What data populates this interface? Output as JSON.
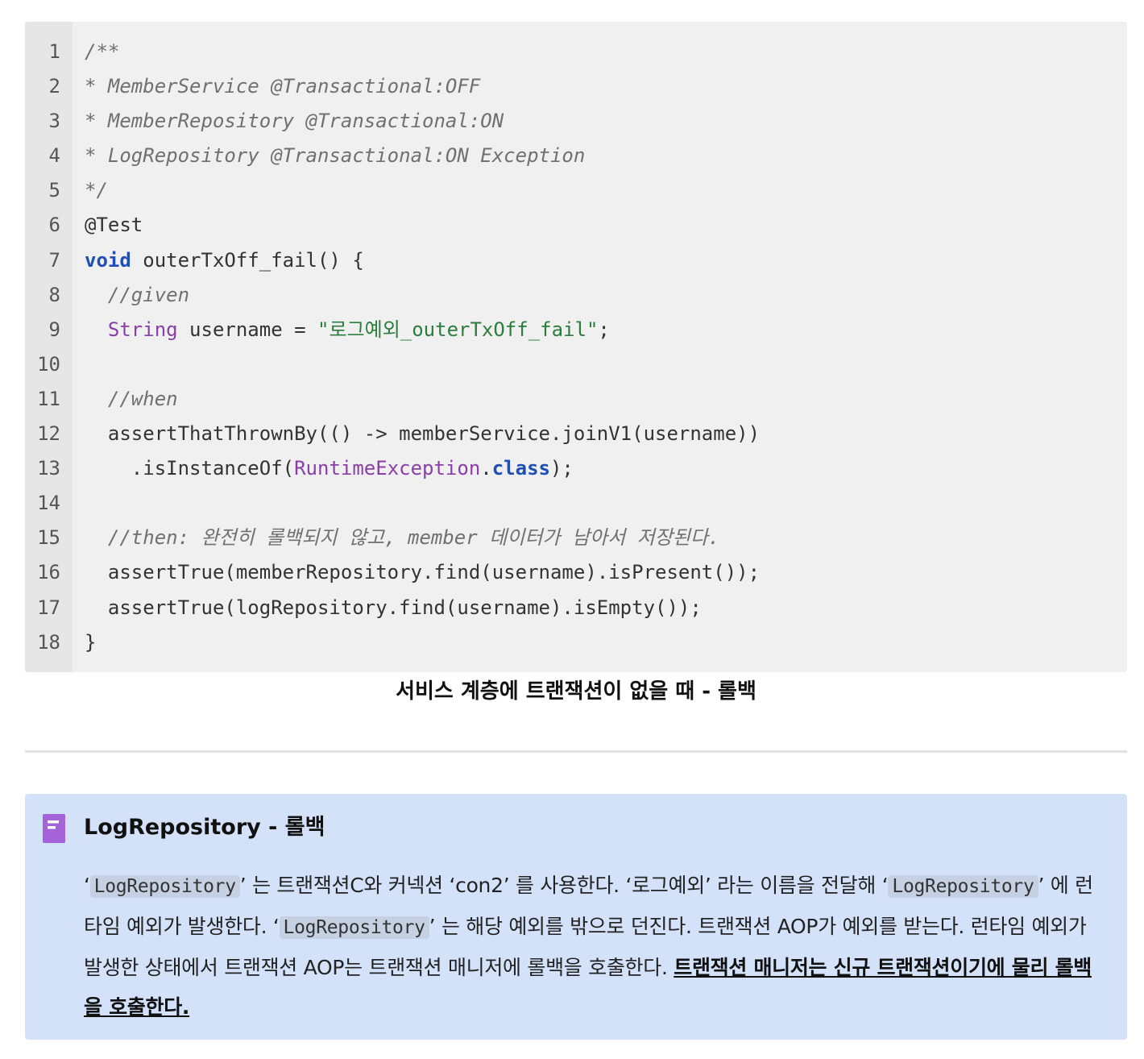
{
  "code": {
    "lines": [
      {
        "n": "1",
        "parts": [
          {
            "t": "/**",
            "c": "cm"
          }
        ]
      },
      {
        "n": "2",
        "parts": [
          {
            "t": "* MemberService @Transactional:OFF",
            "c": "cm"
          }
        ]
      },
      {
        "n": "3",
        "parts": [
          {
            "t": "* MemberRepository @Transactional:ON",
            "c": "cm"
          }
        ]
      },
      {
        "n": "4",
        "parts": [
          {
            "t": "* LogRepository @Transactional:ON Exception",
            "c": "cm"
          }
        ]
      },
      {
        "n": "5",
        "parts": [
          {
            "t": "*/",
            "c": "cm"
          }
        ]
      },
      {
        "n": "6",
        "parts": [
          {
            "t": "@Test",
            "c": ""
          }
        ]
      },
      {
        "n": "7",
        "parts": [
          {
            "t": "void",
            "c": "kw"
          },
          {
            "t": " outerTxOff_fail() {",
            "c": ""
          }
        ]
      },
      {
        "n": "8",
        "parts": [
          {
            "t": "  //given",
            "c": "cm"
          }
        ]
      },
      {
        "n": "9",
        "parts": [
          {
            "t": "  ",
            "c": ""
          },
          {
            "t": "String",
            "c": "ty"
          },
          {
            "t": " username = ",
            "c": ""
          },
          {
            "t": "\"로그예외_outerTxOff_fail\"",
            "c": "st"
          },
          {
            "t": ";",
            "c": ""
          }
        ]
      },
      {
        "n": "10",
        "parts": [
          {
            "t": "",
            "c": ""
          }
        ]
      },
      {
        "n": "11",
        "parts": [
          {
            "t": "  //when",
            "c": "cm"
          }
        ]
      },
      {
        "n": "12",
        "parts": [
          {
            "t": "  assertThatThrownBy(() -> memberService.joinV1(username))",
            "c": ""
          }
        ]
      },
      {
        "n": "13",
        "parts": [
          {
            "t": "    .isInstanceOf(",
            "c": ""
          },
          {
            "t": "RuntimeException",
            "c": "ty"
          },
          {
            "t": ".",
            "c": ""
          },
          {
            "t": "class",
            "c": "kw"
          },
          {
            "t": ");",
            "c": ""
          }
        ]
      },
      {
        "n": "14",
        "parts": [
          {
            "t": "",
            "c": ""
          }
        ]
      },
      {
        "n": "15",
        "parts": [
          {
            "t": "  //then: 완전히 롤백되지 않고, member 데이터가 남아서 저장된다.",
            "c": "cm"
          }
        ]
      },
      {
        "n": "16",
        "parts": [
          {
            "t": "  assertTrue(memberRepository.find(username).isPresent());",
            "c": ""
          }
        ]
      },
      {
        "n": "17",
        "parts": [
          {
            "t": "  assertTrue(logRepository.find(username).isEmpty());",
            "c": ""
          }
        ]
      },
      {
        "n": "18",
        "parts": [
          {
            "t": "}",
            "c": ""
          }
        ]
      }
    ]
  },
  "caption": "서비스 계층에 트랜잭션이 없을 때 - 롤백",
  "callout": {
    "icon": "page-icon",
    "icon_color": "#a463d8",
    "title": "LogRepository - 롤백",
    "body": [
      {
        "t": "‘",
        "k": "text"
      },
      {
        "t": "LogRepository",
        "k": "code"
      },
      {
        "t": "’ 는 트랜잭션C와 커넥션 ‘con2’ 를 사용한다. ‘로그예외’ 라는 이름을 전달해 ",
        "k": "text"
      },
      {
        "t": "‘",
        "k": "text"
      },
      {
        "t": "LogRepository",
        "k": "code"
      },
      {
        "t": "’ 에 런타임 예외가 발생한다. ‘",
        "k": "text"
      },
      {
        "t": "LogRepository",
        "k": "code"
      },
      {
        "t": "’ 는 해당 예외를 밖으로 던진다. 트랜잭션 AOP가 예외를 받는다. 런타임 예외가 발생한 상태에서 트랜잭션 AOP는 트랜잭션 매니저에 롤백을 호출한다. ",
        "k": "text"
      },
      {
        "t": "트랜잭션 매니저는 신규 트랜잭션이기에 물리 롤백을 호출한다.",
        "k": "strong"
      }
    ]
  }
}
